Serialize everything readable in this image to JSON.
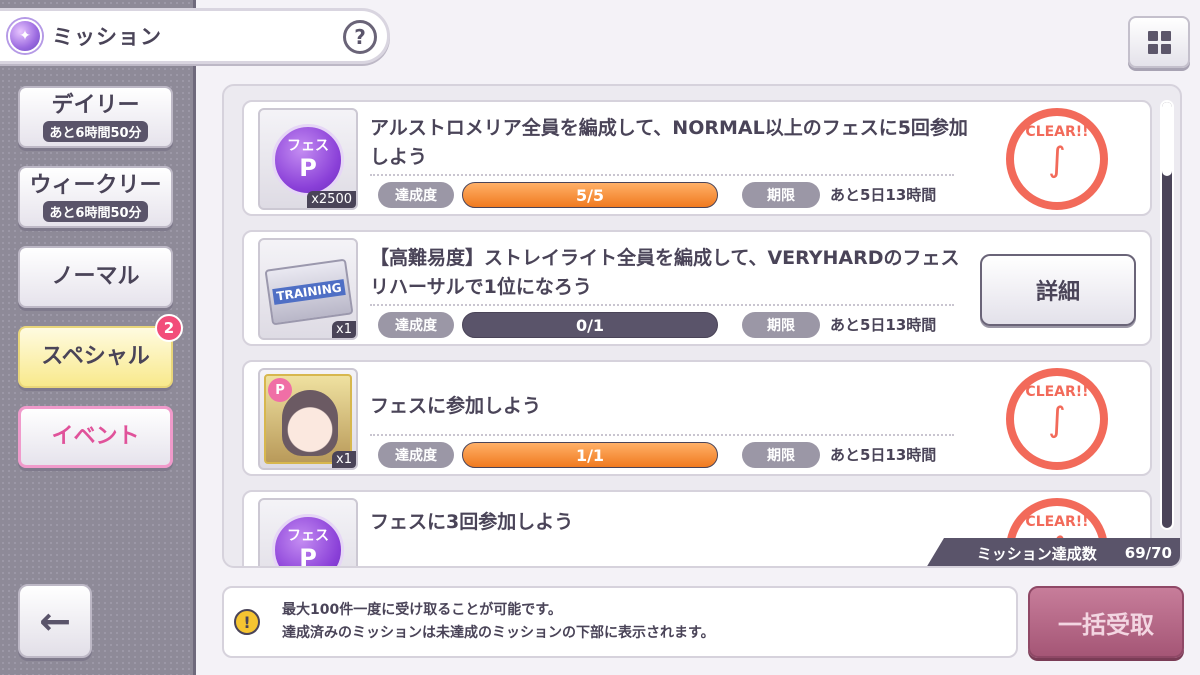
{
  "header": {
    "title": "ミッション",
    "help_label": "?"
  },
  "tabs": [
    {
      "label": "デイリー",
      "sub": "あと6時間50分"
    },
    {
      "label": "ウィークリー",
      "sub": "あと6時間50分"
    },
    {
      "label": "ノーマル"
    },
    {
      "label": "スペシャル",
      "badge": "2"
    },
    {
      "label": "イベント"
    }
  ],
  "missions": [
    {
      "title": "アルストロメリア全員を編成して、NORMAL以上のフェスに5回参加しよう",
      "reward_label": "フェス",
      "reward_symbol": "P",
      "reward_count": "x2500",
      "progress_label": "達成度",
      "progress": "5/5",
      "progress_fraction": 1.0,
      "deadline_label": "期限",
      "deadline": "あと5日13時間",
      "status": "clear",
      "stamp_text": "CLEAR!!"
    },
    {
      "title": "【高難易度】ストレイライト全員を編成して、VERYHARDのフェスリハーサルで1位になろう",
      "reward_ticket": "TRAINING",
      "reward_count": "x1",
      "progress_label": "達成度",
      "progress": "0/1",
      "progress_fraction": 0.0,
      "deadline_label": "期限",
      "deadline": "あと5日13時間",
      "status": "detail",
      "detail_label": "詳細"
    },
    {
      "title": "フェスに参加しよう",
      "reward_tag": "P",
      "reward_count": "x1",
      "progress_label": "達成度",
      "progress": "1/1",
      "progress_fraction": 1.0,
      "deadline_label": "期限",
      "deadline": "あと5日13時間",
      "status": "clear",
      "stamp_text": "CLEAR!!"
    },
    {
      "title": "フェスに3回参加しよう",
      "reward_label": "フェス",
      "reward_symbol": "P",
      "status": "clear",
      "stamp_text": "CLEAR!!"
    }
  ],
  "mission_count": {
    "label": "ミッション達成数",
    "value": "69/70"
  },
  "notice": {
    "line1": "最大100件一度に受け取ることが可能です。",
    "line2": "達成済みのミッションは未達成のミッションの下部に表示されます。"
  },
  "claim_all_label": "一括受取",
  "back_label": "←",
  "warn_symbol": "!",
  "colors": {
    "accent_orange": "#f07a20",
    "clear_red": "#f26a5a",
    "badge_pink": "#f24d7a",
    "event_pink": "#e0529a"
  }
}
